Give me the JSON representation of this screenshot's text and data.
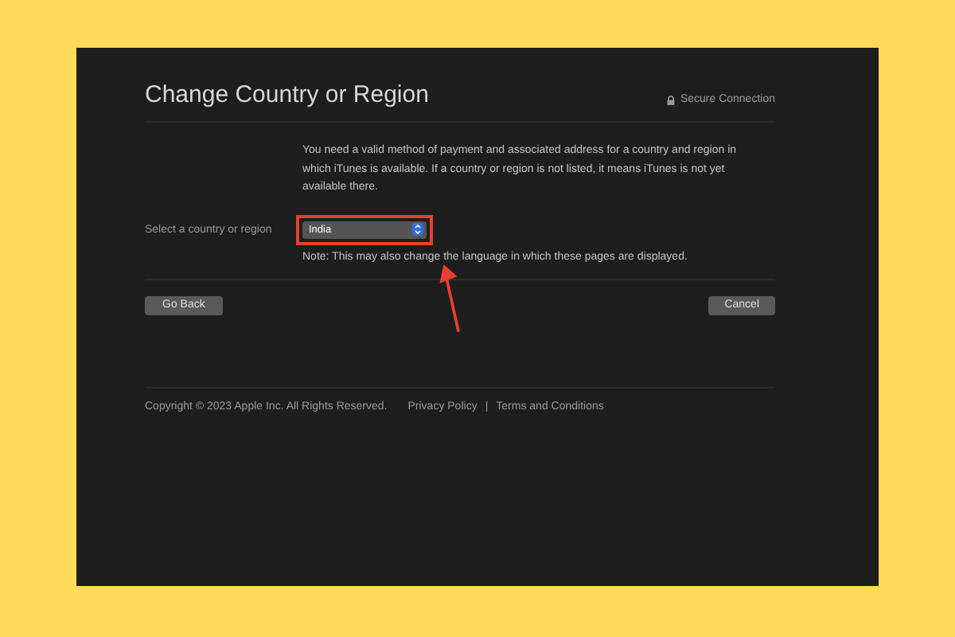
{
  "page": {
    "title": "Change Country or Region",
    "security": "Secure Connection"
  },
  "intro": "You need a valid method of payment and associated address for a country and region in which iTunes is available. If a country or region is not listed, it means iTunes is not yet available there.",
  "country_select": {
    "label": "Select a country or region",
    "value": "India",
    "highlighted": true
  },
  "note": "Note: This may also change the language in which these pages are displayed.",
  "buttons": [
    {
      "kind": "back",
      "label": "Go Back"
    },
    {
      "kind": "cancel",
      "label": "Cancel"
    }
  ],
  "footer": {
    "copyright": "Copyright © 2023 Apple Inc. All Rights Reserved.",
    "links": [
      "Privacy Policy",
      "Terms and Conditions"
    ],
    "separator": "|"
  }
}
